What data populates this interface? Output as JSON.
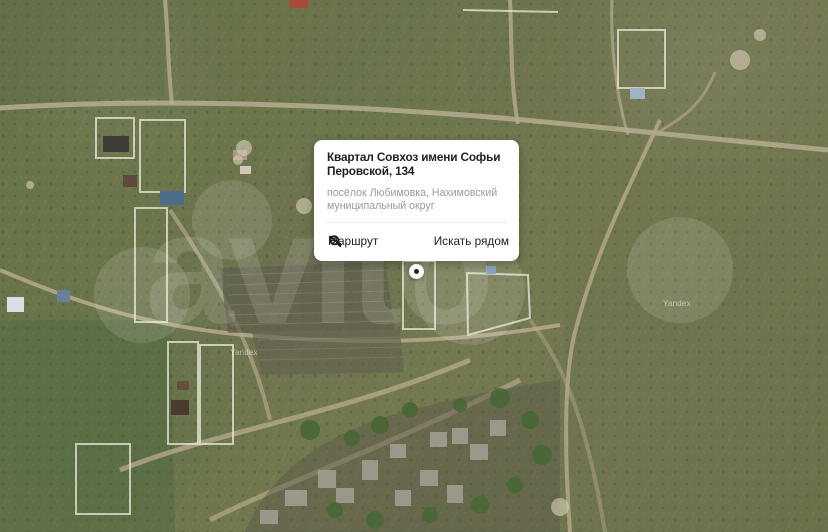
{
  "map": {
    "callout": {
      "title": "Квартал Совхоз имени Софьи Перовской, 134",
      "subtitle": "посёлок Любимовка, Нахимовский муниципальный округ",
      "actions": {
        "route": "Маршрут",
        "search_nearby": "Искать рядом"
      }
    },
    "labels": {
      "yandex_top_right": "Yandex",
      "yandex_left": "Yandex"
    },
    "watermark": "avito"
  }
}
